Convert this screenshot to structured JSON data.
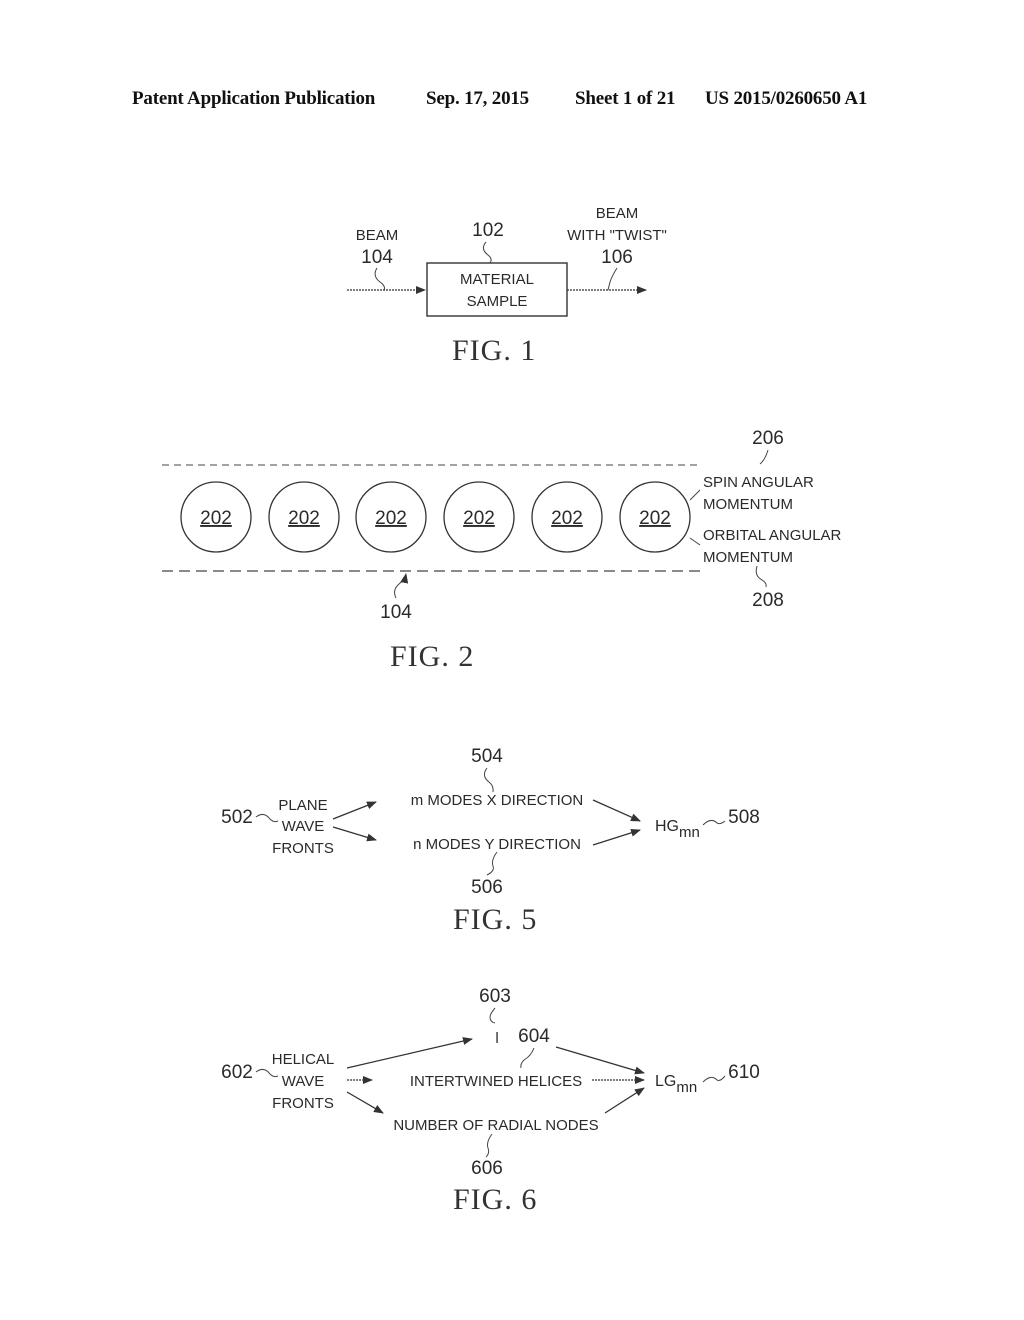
{
  "header": {
    "left": "Patent Application Publication",
    "date": "Sep. 17, 2015",
    "sheet": "Sheet 1 of 21",
    "number": "US 2015/0260650 A1"
  },
  "fig1": {
    "caption": "FIG. 1",
    "input_label": "BEAM",
    "input_ref": "104",
    "box_ref": "102",
    "box_line1": "MATERIAL",
    "box_line2": "SAMPLE",
    "output_label_line1": "BEAM",
    "output_label_line2": "WITH \"TWIST\"",
    "output_ref": "106"
  },
  "fig2": {
    "caption": "FIG. 2",
    "circles": [
      "202",
      "202",
      "202",
      "202",
      "202",
      "202"
    ],
    "beam_ref": "104",
    "spin_ref": "206",
    "spin_line1": "SPIN ANGULAR",
    "spin_line2": "MOMENTUM",
    "orbital_line1": "ORBITAL ANGULAR",
    "orbital_line2": "MOMENTUM",
    "orbital_ref": "208"
  },
  "fig5": {
    "caption": "FIG. 5",
    "source_ref": "502",
    "source_line1": "PLANE",
    "source_line2": "WAVE",
    "source_line3": "FRONTS",
    "upper": "m MODES X DIRECTION",
    "upper_ref": "504",
    "lower": "n MODES Y DIRECTION",
    "lower_ref": "506",
    "result_main": "HG",
    "result_sub": "mn",
    "result_ref": "508"
  },
  "fig6": {
    "caption": "FIG. 6",
    "source_ref": "602",
    "source_line1": "HELICAL",
    "source_line2": "WAVE",
    "source_line3": "FRONTS",
    "top_symbol": "l",
    "top_ref": "603",
    "middle": "INTERTWINED HELICES",
    "middle_ref": "604",
    "bottom": "NUMBER OF RADIAL NODES",
    "bottom_ref": "606",
    "result_main": "LG",
    "result_sub": "mn",
    "result_ref": "610"
  }
}
